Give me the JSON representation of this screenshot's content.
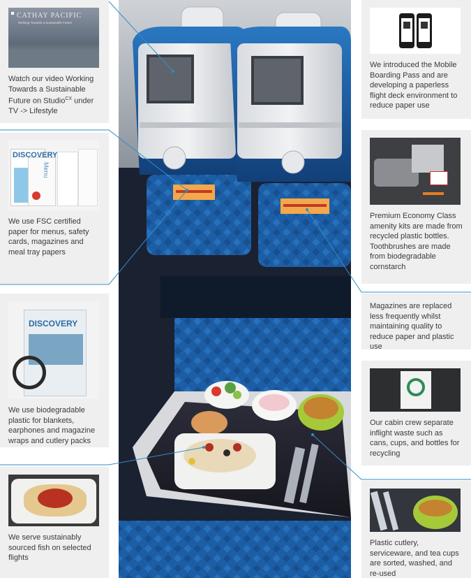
{
  "colors": {
    "card_background": "#efefef",
    "leader_line": "#2f8fc9",
    "seat_blue": "#1a5fa8",
    "text": "#3a3a3a"
  },
  "video": {
    "thumb_title": "CATHAY PACIFIC",
    "thumb_subtitle": "Working Towards a Sustainable Future",
    "caption_a": "Watch our video Working Towards a Sustainable Future on Studio",
    "caption_sup": "CX",
    "caption_b": " under TV -> Lifestyle"
  },
  "fsc": {
    "thumb_title": "DISCOVERY",
    "menu_word": "Menu",
    "caption": "We use FSC certified paper for menus, safety cards, magazines and meal tray papers"
  },
  "plastic": {
    "thumb_title": "DISCOVERY",
    "caption": "We use biodegradable plastic for blankets, earphones and magazine wraps and cutlery packs"
  },
  "fish": {
    "caption": "We serve sustainably sourced fish on selected flights"
  },
  "boarding": {
    "caption": "We introduced the Mobile Boarding Pass and are developing a paperless flight deck environment to reduce paper use"
  },
  "amenity": {
    "caption": "Premium Economy Class amenity kits are made from recycled plastic bottles. Toothbrushes are made from biodegradable cornstarch"
  },
  "magazines": {
    "caption": "Magazines are replaced less frequently whilst maintaining quality to reduce paper and plastic use"
  },
  "recycling": {
    "caption": "Our cabin crew separate inflight waste such as cans, cups, and bottles for recycling"
  },
  "cutlery": {
    "caption": "Plastic cutlery, serviceware, and tea cups are sorted, washed, and re-used"
  }
}
